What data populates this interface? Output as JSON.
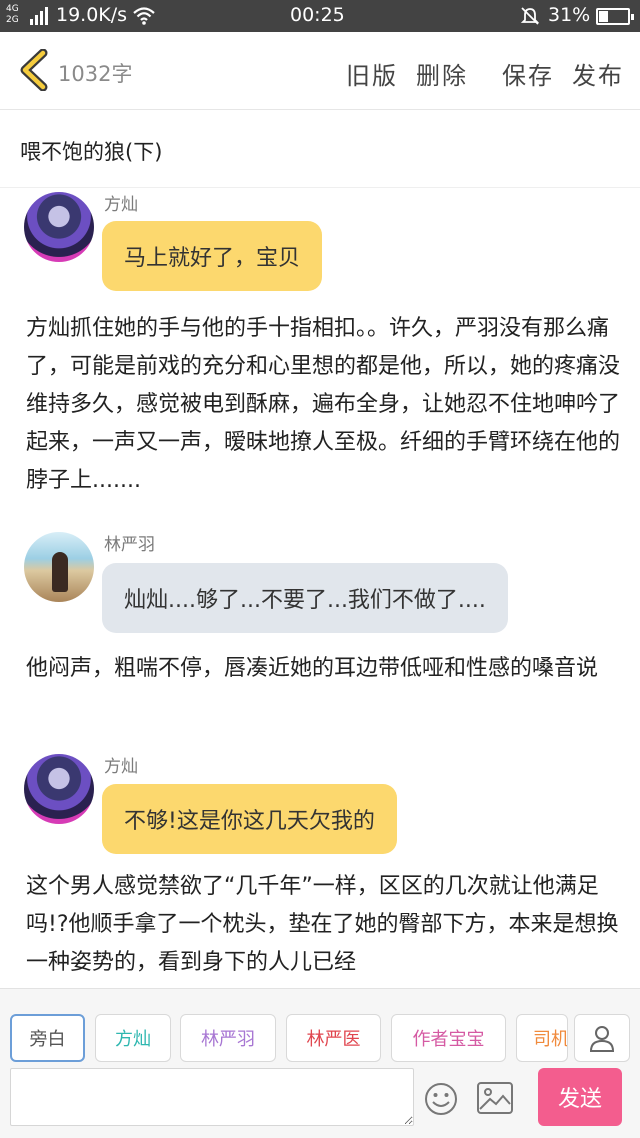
{
  "status_bar": {
    "network_type_top": "4G",
    "network_type_bottom": "2G",
    "speed": "19.0K/s",
    "time": "00:25",
    "battery_percent": "31%",
    "battery_level": 0.31
  },
  "header": {
    "word_count": "1032字",
    "buttons": [
      "旧版",
      "删除",
      "保存",
      "发布"
    ]
  },
  "story_title": "喂不饱的狼(下)",
  "messages": [
    {
      "speaker": "方灿",
      "text": "马上就好了，宝贝",
      "bubble": "yellow"
    },
    {
      "narration": "方灿抓住她的手与他的手十指相扣。。许久，严羽没有那么痛了，可能是前戏的充分和心里想的都是他，所以，她的疼痛没维持多久，感觉被电到酥麻，遍布全身，让她忍不住地呻吟了起来，一声又一声，暧昧地撩人至极。纤细的手臂环绕在他的脖子上......."
    },
    {
      "speaker": "林严羽",
      "text": "灿灿....够了...不要了...我们不做了....",
      "bubble": "gray"
    },
    {
      "narration": "他闷声，粗喘不停，唇凑近她的耳边带低哑和性感的嗓音说"
    },
    {
      "speaker": "方灿",
      "text": "不够!这是你这几天欠我的",
      "bubble": "yellow"
    },
    {
      "narration": "这个男人感觉禁欲了“几千年”一样，区区的几次就让他满足吗!?他顺手拿了一个枕头，垫在了她的臀部下方，本来是想换一种姿势的，看到身下的人儿已经"
    }
  ],
  "role_chips": [
    {
      "label": "旁白",
      "color": "#555555"
    },
    {
      "label": "方灿",
      "color": "#2fb7b0"
    },
    {
      "label": "林严羽",
      "color": "#a877d3"
    },
    {
      "label": "林严医",
      "color": "#e0464f"
    },
    {
      "label": "作者宝宝",
      "color": "#d55aa3"
    },
    {
      "label": "司机",
      "color": "#f08a3c"
    }
  ],
  "input": {
    "placeholder": ""
  },
  "send_label": "发送"
}
